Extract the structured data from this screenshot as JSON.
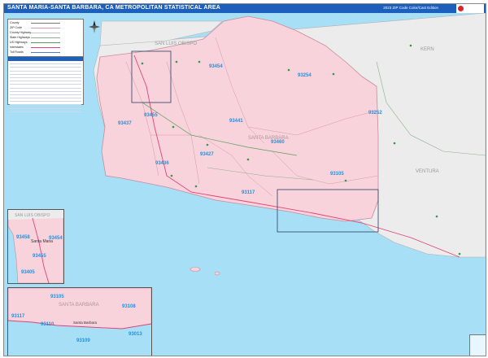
{
  "header": {
    "title": "SANTA MARIA-SANTA BARBARA, CA METROPOLITAN STATISTICAL AREA",
    "edition": "2023 ZIP Code Color/Cast Edition"
  },
  "map": {
    "counties": [
      "SAN LUIS OBISPO",
      "KERN",
      "SANTA BARBARA",
      "VENTURA"
    ],
    "main_zip_labels": [
      "93454",
      "93254",
      "93252",
      "93441",
      "93460",
      "93437",
      "93436",
      "93427",
      "93105",
      "93117",
      "93455"
    ],
    "inset1_city": "Santa Maria",
    "inset1_zips": [
      "93458",
      "93454",
      "93455",
      "93405"
    ],
    "inset1_county": "SAN LUIS OBISPO",
    "inset2_county": "SANTA BARBARA",
    "inset2_city": "Santa Barbara",
    "inset2_zips": [
      "93105",
      "93108",
      "93117",
      "93110",
      "93013",
      "93109"
    ],
    "water_color": "#a7dff6",
    "zip_fill_color": "#f8d3dc",
    "neighbor_fill_color": "#ececec",
    "zip_label_color": "#2a8fd8"
  },
  "legend": {
    "items": [
      "County",
      "ZIP Code",
      "County Highway",
      "State Highways",
      "US Highways",
      "Interstates",
      "Toll Roads"
    ]
  }
}
